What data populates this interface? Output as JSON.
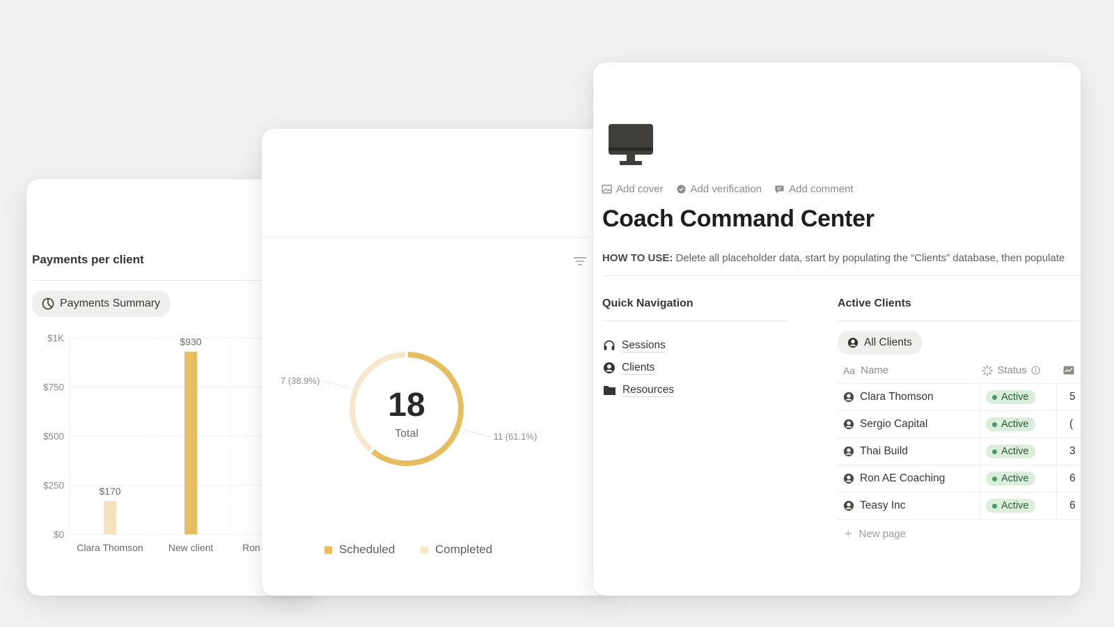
{
  "payments_card": {
    "title": "Payments per client",
    "view_label": "Payments Summary",
    "chart_data": {
      "type": "bar",
      "title": "",
      "categories": [
        "Clara Thomson",
        "New client",
        "Ron"
      ],
      "series": [
        {
          "values": [
            170,
            930,
            null
          ]
        }
      ],
      "data_labels": [
        "$170",
        "$930",
        ""
      ],
      "y_tick_labels": [
        "$0",
        "$250",
        "$500",
        "$750",
        "$1K"
      ],
      "y_ticks": [
        0,
        250,
        500,
        750,
        1000
      ],
      "ylim": [
        0,
        1000
      ],
      "grid": true,
      "bar_colors": [
        "#f5e2bf",
        "#e7bd61",
        "#e7bd61"
      ]
    }
  },
  "donut_card": {
    "chart_data": {
      "type": "pie",
      "center_value": "18",
      "center_label": "Total",
      "series": [
        {
          "name": "Scheduled",
          "value": 11,
          "label": "11 (61.1%)",
          "color": "#e7bd61"
        },
        {
          "name": "Completed",
          "value": 7,
          "label": "7 (38.9%)",
          "color": "#f6e8cc"
        }
      ],
      "legend": [
        "Scheduled",
        "Completed"
      ],
      "legend_position": "bottom"
    }
  },
  "main_card": {
    "icon": "computer-icon",
    "actions": [
      {
        "label": "Add cover",
        "icon": "image-icon"
      },
      {
        "label": "Add verification",
        "icon": "verified-badge-icon"
      },
      {
        "label": "Add comment",
        "icon": "comment-icon"
      }
    ],
    "title": "Coach Command Center",
    "howto_prefix": "HOW TO USE:",
    "howto_text": " Delete all placeholder data, start by populating the “Clients” database, then populate",
    "quick_nav": {
      "title": "Quick Navigation",
      "items": [
        {
          "label": "Sessions",
          "icon": "headset-icon"
        },
        {
          "label": "Clients",
          "icon": "user-circle-icon"
        },
        {
          "label": "Resources",
          "icon": "folder-icon"
        }
      ]
    },
    "active_clients": {
      "title": "Active Clients",
      "view_label": "All Clients",
      "columns": {
        "name": "Name",
        "status": "Status"
      },
      "rows": [
        {
          "name": "Clara Thomson",
          "status": "Active",
          "extra": "5"
        },
        {
          "name": "Sergio Capital",
          "status": "Active",
          "extra": "("
        },
        {
          "name": "Thai Build",
          "status": "Active",
          "extra": "3"
        },
        {
          "name": "Ron AE Coaching",
          "status": "Active",
          "extra": "6"
        },
        {
          "name": "Teasy Inc",
          "status": "Active",
          "extra": "6"
        }
      ],
      "new_page_label": "New page"
    }
  },
  "colors": {
    "accent": "#e7bd61",
    "accent_light": "#f5e2bf",
    "status_green_bg": "#dbeddb",
    "status_green_dot": "#4c9a6a"
  }
}
